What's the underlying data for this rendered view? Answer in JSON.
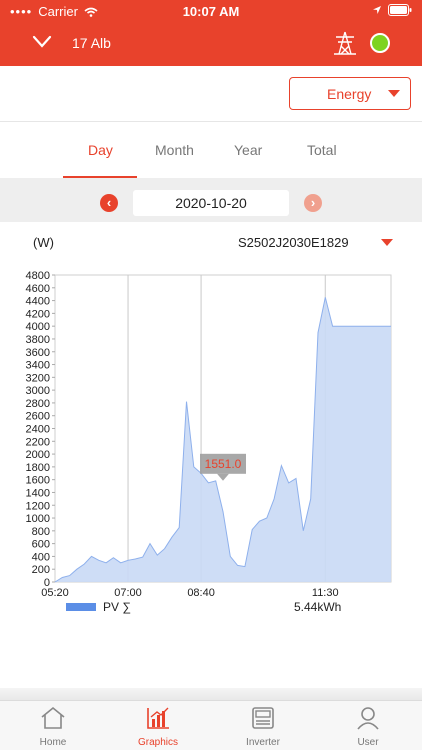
{
  "status": {
    "carrier": "Carrier",
    "time": "10:07 AM"
  },
  "header": {
    "plant_name": "17 Alb",
    "online_color": "#7ed321"
  },
  "select": {
    "value": "Energy"
  },
  "tabs": [
    {
      "label": "Day",
      "active": true
    },
    {
      "label": "Month"
    },
    {
      "label": "Year"
    },
    {
      "label": "Total"
    }
  ],
  "date": {
    "value": "2020-10-20"
  },
  "chart_header": {
    "unit": "(W)",
    "device": "S2502J2030E1829"
  },
  "chart_data": {
    "type": "area",
    "title": "",
    "xlabel": "",
    "ylabel": "(W)",
    "ylim": [
      0,
      4800
    ],
    "y_ticks": [
      0,
      200,
      400,
      600,
      800,
      1000,
      1200,
      1400,
      1600,
      1800,
      2000,
      2200,
      2400,
      2600,
      2800,
      3000,
      3200,
      3400,
      3600,
      3800,
      4000,
      4200,
      4400,
      4600,
      4800
    ],
    "x_ticks": [
      "05:20",
      "07:00",
      "08:40",
      "11:30"
    ],
    "grid": true,
    "tooltip": {
      "x": "09:10",
      "value": "1551.0"
    },
    "series": [
      {
        "name": "PV ∑",
        "color": "#5b8ee6",
        "x": [
          "05:20",
          "05:30",
          "05:40",
          "05:50",
          "06:00",
          "06:10",
          "06:20",
          "06:30",
          "06:40",
          "06:50",
          "07:00",
          "07:10",
          "07:20",
          "07:30",
          "07:40",
          "07:50",
          "08:00",
          "08:10",
          "08:20",
          "08:30",
          "08:40",
          "08:50",
          "09:00",
          "09:10",
          "09:20",
          "09:30",
          "09:40",
          "09:50",
          "10:00",
          "10:10",
          "10:20",
          "10:30",
          "10:40",
          "10:50",
          "11:00",
          "11:10",
          "11:20",
          "11:30",
          "11:40",
          "11:50",
          "12:00",
          "12:10",
          "12:20",
          "12:30",
          "12:40",
          "12:50",
          "13:00"
        ],
        "values": [
          0,
          70,
          100,
          200,
          280,
          400,
          340,
          300,
          380,
          300,
          340,
          360,
          390,
          600,
          420,
          520,
          700,
          850,
          2820,
          1800,
          1700,
          1551,
          1580,
          1100,
          400,
          260,
          240,
          820,
          950,
          1000,
          1300,
          1820,
          1550,
          1620,
          800,
          1300,
          3900,
          4450,
          4000,
          4000,
          4000,
          4000,
          4000,
          4000,
          4000,
          4000,
          4000
        ]
      }
    ],
    "legend": {
      "placement": "bottom-left"
    },
    "total_label": "5.44kWh"
  },
  "tabbar": [
    {
      "label": "Home",
      "icon": "home-icon"
    },
    {
      "label": "Graphics",
      "icon": "bar-chart-icon",
      "active": true
    },
    {
      "label": "Inverter",
      "icon": "inverter-icon"
    },
    {
      "label": "User",
      "icon": "user-icon"
    }
  ]
}
